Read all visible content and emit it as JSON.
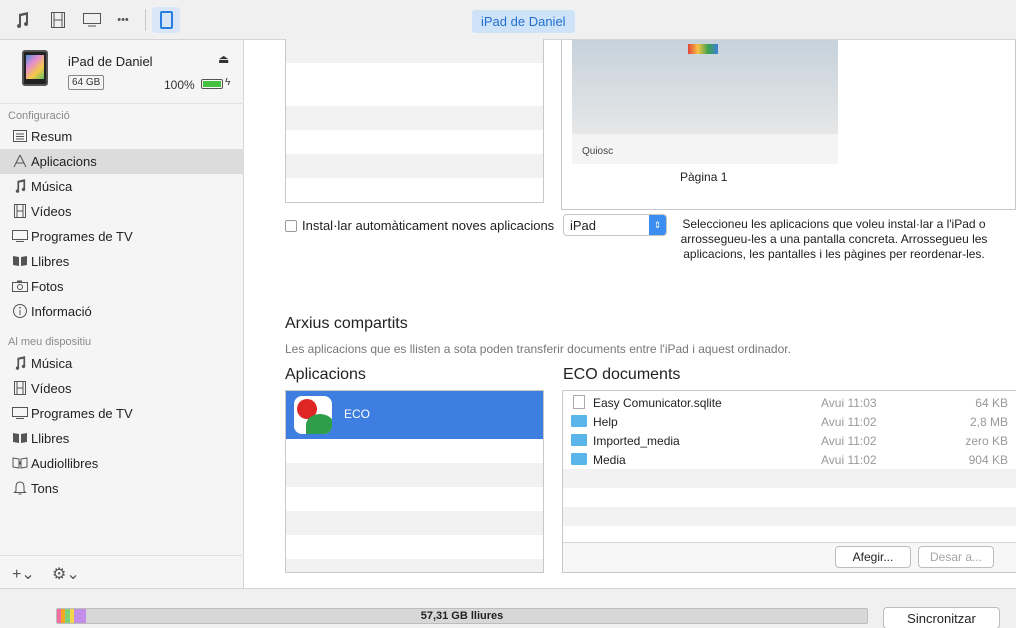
{
  "toolbar": {
    "icons": [
      "music-note-icon",
      "film-icon",
      "tv-icon",
      "more-icon",
      "ipad-icon"
    ],
    "more_glyph": "•••",
    "device_name": "iPad de Daniel"
  },
  "sidebar": {
    "device": {
      "name": "iPad de Daniel",
      "capacity": "64 GB",
      "battery_percent": "100%",
      "battery_level": 1.0
    },
    "settings_title": "Configuració",
    "settings_items": [
      {
        "label": "Resum",
        "icon": "list-icon"
      },
      {
        "label": "Aplicacions",
        "icon": "apps-icon",
        "selected": true
      },
      {
        "label": "Música",
        "icon": "music-note-icon"
      },
      {
        "label": "Vídeos",
        "icon": "film-icon"
      },
      {
        "label": "Programes de TV",
        "icon": "tv-icon"
      },
      {
        "label": "Llibres",
        "icon": "book-icon"
      },
      {
        "label": "Fotos",
        "icon": "camera-icon"
      },
      {
        "label": "Informació",
        "icon": "info-icon"
      }
    ],
    "device_title": "Al meu dispositiu",
    "device_items": [
      {
        "label": "Música",
        "icon": "music-note-icon"
      },
      {
        "label": "Vídeos",
        "icon": "film-icon"
      },
      {
        "label": "Programes de TV",
        "icon": "tv-icon"
      },
      {
        "label": "Llibres",
        "icon": "book-icon"
      },
      {
        "label": "Audiollibres",
        "icon": "audiobook-icon"
      },
      {
        "label": "Tons",
        "icon": "bell-icon"
      }
    ],
    "add_glyph": "+⌄",
    "gear_glyph": "⚙⌄"
  },
  "main": {
    "page_preview": {
      "app_label": "Quiosc",
      "page_label": "Pàgina 1"
    },
    "auto_install_label": "Instal·lar automàticament noves aplicacions",
    "auto_install_checked": false,
    "device_select_value": "iPad",
    "hint_text": "Seleccioneu les aplicacions que voleu instal·lar a l'iPad o arrossegueu-les a una pantalla concreta. Arrossegueu les aplicacions, les pantalles i les pàgines per reordenar-les.",
    "shared_files_title": "Arxius compartits",
    "shared_files_desc": "Les aplicacions que es llisten a sota poden transferir documents entre l'iPad i aquest ordinador.",
    "apps_title": "Aplicacions",
    "apps": [
      {
        "name": "ECO"
      }
    ],
    "docs_title": "ECO documents",
    "documents": [
      {
        "name": "Easy Comunicator.sqlite",
        "date": "Avui 11:03",
        "size": "64 KB",
        "kind": "file"
      },
      {
        "name": "Help",
        "date": "Avui 11:02",
        "size": "2,8 MB",
        "kind": "folder"
      },
      {
        "name": "Imported_media",
        "date": "Avui 11:02",
        "size": "zero KB",
        "kind": "folder"
      },
      {
        "name": "Media",
        "date": "Avui 11:02",
        "size": "904 KB",
        "kind": "folder"
      }
    ],
    "add_button": "Afegir...",
    "save_button": "Desar a..."
  },
  "footer": {
    "free_space": "57,31 GB lliures",
    "sync_button": "Sincronitzar",
    "usage_colors": [
      "#f26fa4",
      "#f5a623",
      "#7ed07a",
      "#f3d54a",
      "#c28ee8"
    ]
  }
}
